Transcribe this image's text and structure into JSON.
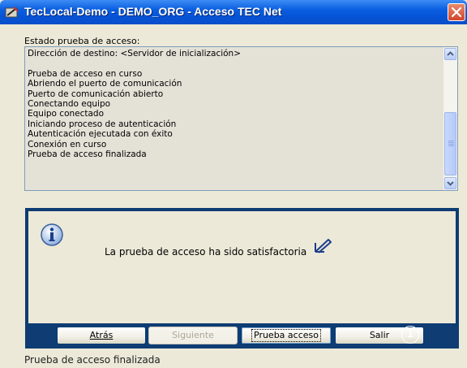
{
  "window": {
    "title": "TecLocal-Demo - DEMO_ORG - Acceso TEC Net"
  },
  "log": {
    "label": "Estado prueba de acceso:",
    "lines": [
      "Dirección de destino: <Servidor de inicialización>",
      "",
      "Prueba de acceso en curso",
      "Abriendo el puerto de comunicación",
      "Puerto de comunicación abierto",
      "Conectando equipo",
      "Equipo conectado",
      "Iniciando proceso de autenticación",
      "Autenticación ejecutada con éxito",
      "Conexión en curso",
      "Prueba de acceso finalizada"
    ]
  },
  "message": {
    "text": "La prueba de acceso ha sido satisfactoria",
    "icon": "info-icon"
  },
  "buttons": {
    "back_label": "Atrás",
    "next_label": "Siguiente",
    "test_label": "Prueba acceso",
    "exit_label": "Salir"
  },
  "annotation": {
    "number": "1"
  },
  "status_bar": {
    "text": "Prueba de acceso finalizada"
  },
  "colors": {
    "titlebar": "#0553d6",
    "panel_border": "#0e3c73",
    "close_button": "#d2452c"
  }
}
